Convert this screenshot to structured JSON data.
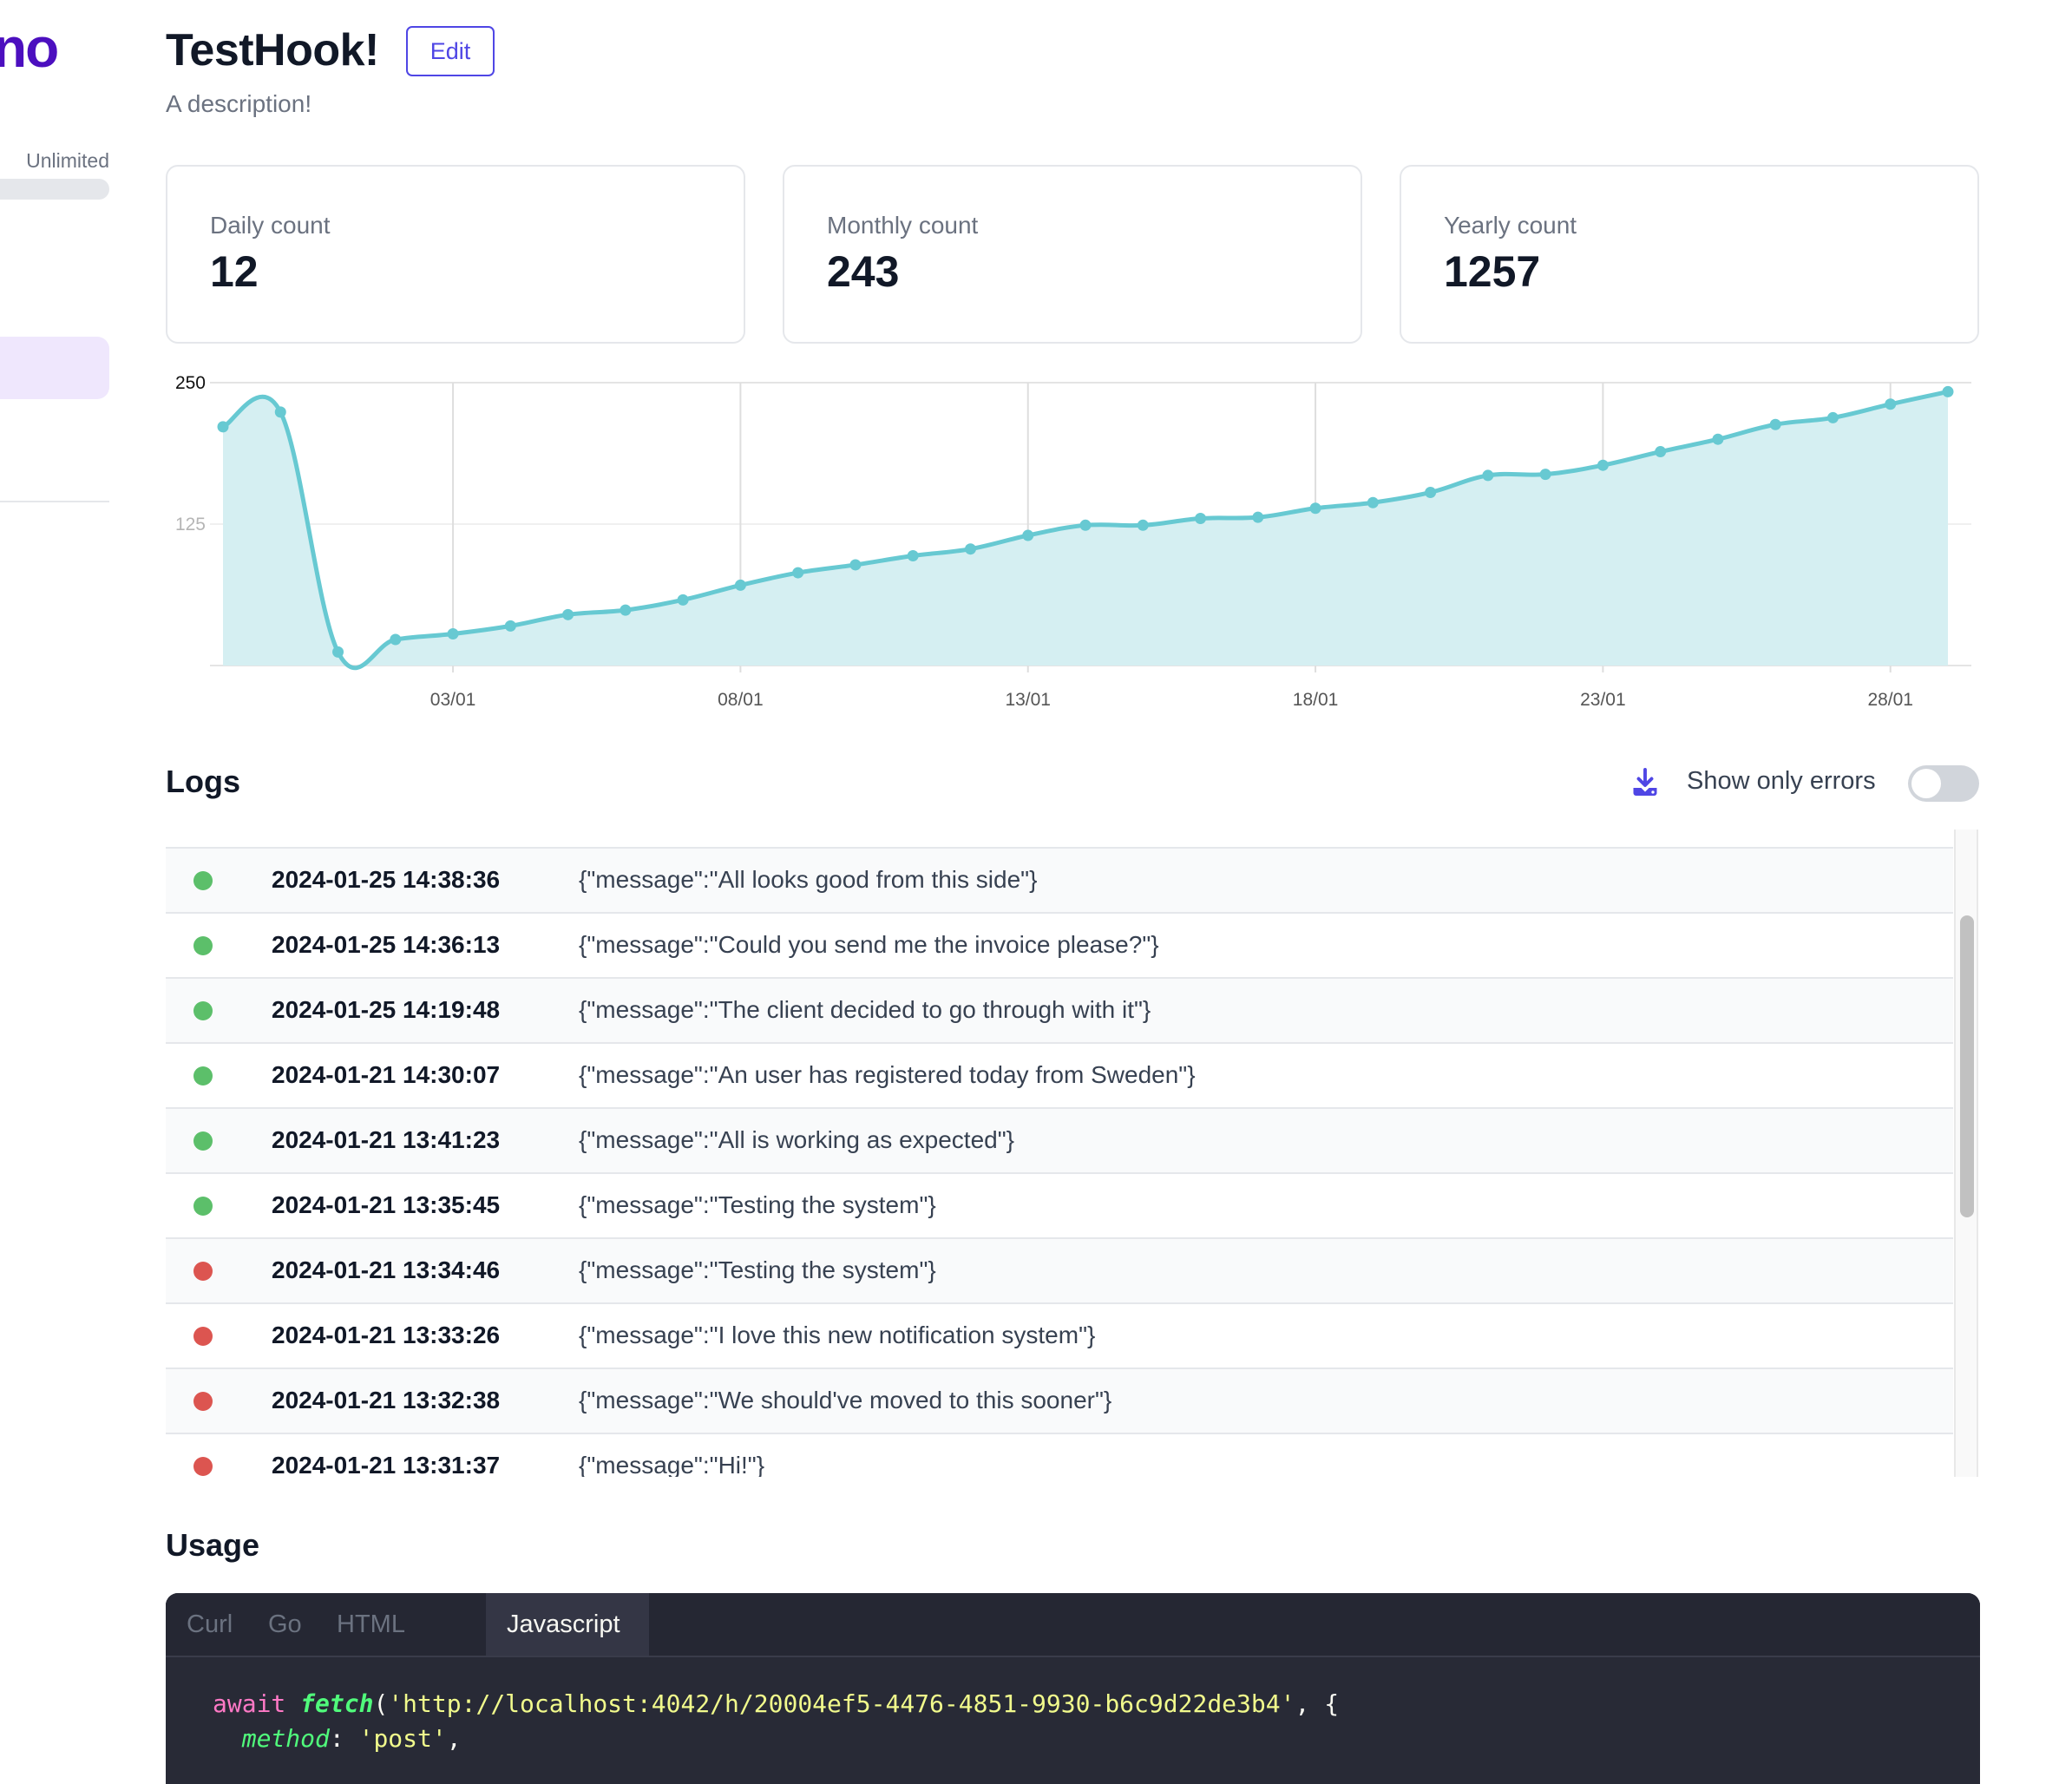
{
  "sidebar": {
    "logo_text": "no",
    "plan_label": "Unlimited",
    "brand_color": "#4c0fbf"
  },
  "header": {
    "title": "TestHook!",
    "edit_label": "Edit",
    "description": "A description!"
  },
  "stats": [
    {
      "label": "Daily count",
      "value": "12"
    },
    {
      "label": "Monthly count",
      "value": "243"
    },
    {
      "label": "Yearly count",
      "value": "1257"
    }
  ],
  "chart_data": {
    "type": "area",
    "title": "",
    "xlabel": "",
    "ylabel": "",
    "x": [
      "30/12",
      "31/12",
      "01/01",
      "02/01",
      "03/01",
      "04/01",
      "05/01",
      "06/01",
      "07/01",
      "08/01",
      "09/01",
      "10/01",
      "11/01",
      "12/01",
      "13/01",
      "14/01",
      "15/01",
      "16/01",
      "17/01",
      "18/01",
      "19/01",
      "20/01",
      "21/01",
      "22/01",
      "23/01",
      "24/01",
      "25/01",
      "26/01",
      "27/01",
      "28/01",
      "29/01"
    ],
    "values": [
      211,
      224,
      12,
      23,
      28,
      35,
      45,
      49,
      58,
      71,
      82,
      89,
      97,
      103,
      115,
      124,
      124,
      130,
      131,
      139,
      144,
      153,
      168,
      169,
      177,
      189,
      200,
      213,
      219,
      231,
      242
    ],
    "ylim": [
      0,
      250
    ],
    "yticks": [
      "125",
      "250"
    ],
    "xticks": [
      "03/01",
      "08/01",
      "13/01",
      "18/01",
      "23/01",
      "28/01"
    ],
    "grid": true,
    "line_color": "#67c9d2",
    "fill_color": "#d5eff2"
  },
  "logs": {
    "title": "Logs",
    "download_icon": "download-icon",
    "filter_label": "Show only errors",
    "filter_on": false,
    "status_colors": {
      "ok": "#5cbf6a",
      "error": "#dc5550"
    },
    "rows": [
      {
        "status": "ok",
        "timestamp": "2024-01-25 14:38:36",
        "message": "{\"message\":\"All looks good from this side\"}"
      },
      {
        "status": "ok",
        "timestamp": "2024-01-25 14:36:13",
        "message": "{\"message\":\"Could you send me the invoice please?\"}"
      },
      {
        "status": "ok",
        "timestamp": "2024-01-25 14:19:48",
        "message": "{\"message\":\"The client decided to go through with it\"}"
      },
      {
        "status": "ok",
        "timestamp": "2024-01-21 14:30:07",
        "message": "{\"message\":\"An user has registered today from Sweden\"}"
      },
      {
        "status": "ok",
        "timestamp": "2024-01-21 13:41:23",
        "message": "{\"message\":\"All is working as expected\"}"
      },
      {
        "status": "ok",
        "timestamp": "2024-01-21 13:35:45",
        "message": "{\"message\":\"Testing the system\"}"
      },
      {
        "status": "error",
        "timestamp": "2024-01-21 13:34:46",
        "message": "{\"message\":\"Testing the system\"}"
      },
      {
        "status": "error",
        "timestamp": "2024-01-21 13:33:26",
        "message": "{\"message\":\"I love this new notification system\"}"
      },
      {
        "status": "error",
        "timestamp": "2024-01-21 13:32:38",
        "message": "{\"message\":\"We should've moved to this sooner\"}"
      },
      {
        "status": "error",
        "timestamp": "2024-01-21 13:31:37",
        "message": "{\"message\":\"Hi!\"}"
      }
    ]
  },
  "usage": {
    "title": "Usage",
    "tabs": [
      "Curl",
      "Go",
      "HTML",
      "Javascript"
    ],
    "active_tab": "Javascript",
    "code": {
      "line1_kw": "await",
      "line1_fn": "fetch",
      "line1_url": "'http://localhost:4042/h/20004ef5-4476-4851-9930-b6c9d22de3b4'",
      "line1_tail": ", {",
      "line2_prop": "method",
      "line2_val": "'post'",
      "line2_tail": ","
    }
  }
}
